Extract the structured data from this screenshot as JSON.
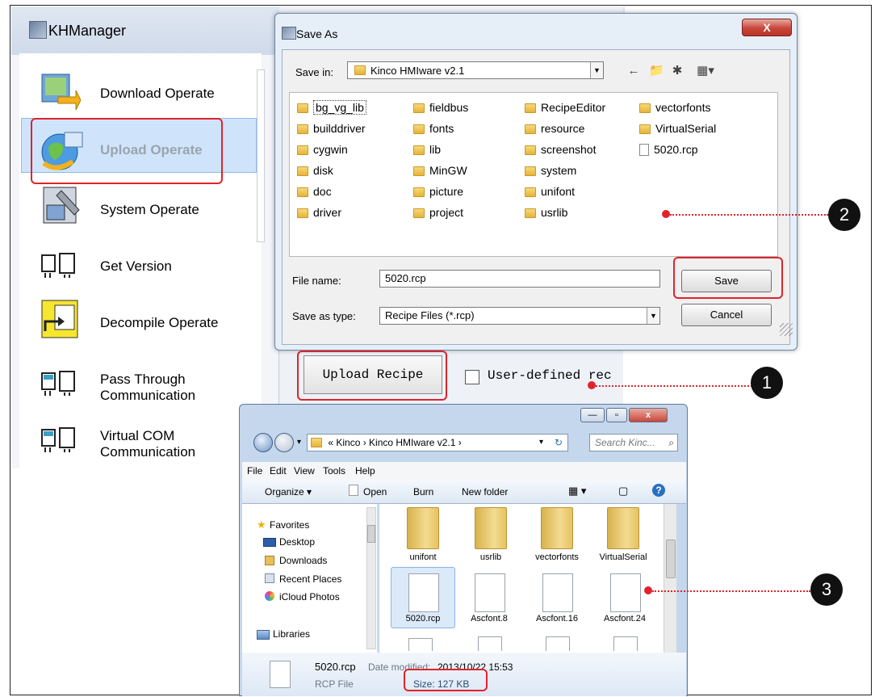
{
  "khmanager": {
    "title": "KHManager",
    "items": [
      {
        "label": "Download Operate",
        "icon": "download-operate-icon"
      },
      {
        "label": "Upload Operate",
        "icon": "upload-operate-icon"
      },
      {
        "label": "System Operate",
        "icon": "system-operate-icon"
      },
      {
        "label": "Get Version",
        "icon": "get-version-icon"
      },
      {
        "label": "Decompile Operate",
        "icon": "decompile-operate-icon"
      },
      {
        "label": "Pass Through",
        "label2": "Communication",
        "icon": "pass-through-icon"
      },
      {
        "label": "Virtual COM",
        "label2": "Communication",
        "icon": "virtual-com-icon"
      }
    ],
    "upload_recipe_label": "Upload Recipe",
    "user_defined_label": "User-defined rec"
  },
  "save_dialog": {
    "title": "Save As",
    "save_in_label": "Save in:",
    "save_in_value": "Kinco HMIware v2.1",
    "folders_col1": [
      "bg_vg_lib",
      "builddriver",
      "cygwin",
      "disk",
      "doc",
      "driver"
    ],
    "folders_col2": [
      "fieldbus",
      "fonts",
      "lib",
      "MinGW",
      "picture",
      "project"
    ],
    "folders_col3": [
      "RecipeEditor",
      "resource",
      "screenshot",
      "system",
      "unifont",
      "usrlib"
    ],
    "folders_col4": [
      "vectorfonts",
      "VirtualSerial"
    ],
    "file_col4": "5020.rcp",
    "file_name_label": "File name:",
    "file_name_value": "5020.rcp",
    "save_type_label": "Save as type:",
    "save_type_value": "Recipe Files (*.rcp)",
    "save_button": "Save",
    "cancel_button": "Cancel",
    "close_glyph": "X"
  },
  "explorer": {
    "address": "« Kinco › Kinco HMIware v2.1 ›",
    "search_placeholder": "Search Kinc...",
    "menu": [
      "File",
      "Edit",
      "View",
      "Tools",
      "Help"
    ],
    "commands": [
      "Organize ▾",
      "Open",
      "Burn",
      "New folder"
    ],
    "nav": [
      "Favorites",
      "Desktop",
      "Downloads",
      "Recent Places",
      "iCloud Photos",
      "Libraries"
    ],
    "folders": [
      "unifont",
      "usrlib",
      "vectorfonts",
      "VirtualSerial"
    ],
    "files": [
      "5020.rcp",
      "Ascfont.8",
      "Ascfont.16",
      "Ascfont.24"
    ],
    "details_name": "5020.rcp",
    "details_modified_label": "Date modified:",
    "details_modified_value": "2013/10/22 15:53",
    "details_type": "RCP File",
    "details_size": "Size: 127 KB"
  },
  "callouts": [
    "1",
    "2",
    "3"
  ],
  "colors": {
    "accent_red": "#e0232b",
    "selection_blue": "#cfe4fb"
  }
}
